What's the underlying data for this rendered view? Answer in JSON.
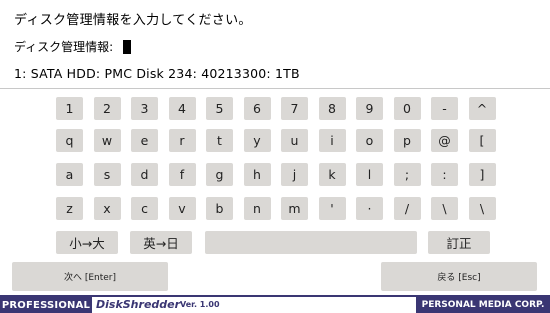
{
  "prompt": "ディスク管理情報を入力してください。",
  "field_label": "ディスク管理情報:",
  "field_value": "",
  "disk_info": "1: SATA HDD: PMC Disk 234: 40213300: 1TB",
  "keys": {
    "row1": [
      "1",
      "2",
      "3",
      "4",
      "5",
      "6",
      "7",
      "8",
      "9",
      "0",
      "-",
      "^"
    ],
    "row2": [
      "q",
      "w",
      "e",
      "r",
      "t",
      "y",
      "u",
      "i",
      "o",
      "p",
      "@",
      "["
    ],
    "row3": [
      "a",
      "s",
      "d",
      "f",
      "g",
      "h",
      "j",
      "k",
      "l",
      ";",
      ":",
      "]"
    ],
    "row4": [
      "z",
      "x",
      "c",
      "v",
      "b",
      "n",
      "m",
      "'",
      "·",
      "/",
      "\\",
      "\\"
    ]
  },
  "mode_keys": {
    "small_large": "小→大",
    "alpha_jp": "英→日",
    "convert": "訂正"
  },
  "buttons": {
    "enter": "次へ [Enter]",
    "back": "戻る [Esc]"
  },
  "footer": {
    "brand": "PROFESSIONAL",
    "product": "DiskShredder",
    "version": "Ver. 1.00",
    "company": "PERSONAL MEDIA CORP."
  },
  "colors": {
    "accent": "#3a3673",
    "key_bg": "#dad8d5"
  }
}
